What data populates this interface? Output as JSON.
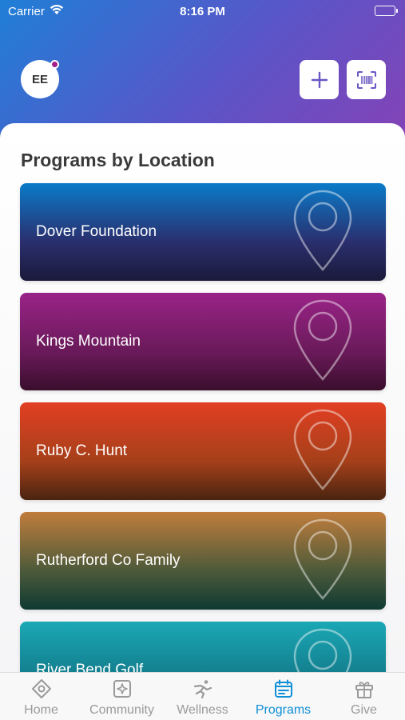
{
  "status_bar": {
    "carrier": "Carrier",
    "time": "8:16 PM"
  },
  "header": {
    "avatar_initials": "EE",
    "notification_dot_color": "#a11e8e",
    "add_icon": "plus-icon",
    "scan_icon": "barcode-scan-icon",
    "gradient_colors": [
      "#1f7fd6",
      "#5a55c8",
      "#8d3fb3"
    ]
  },
  "main": {
    "section_title": "Programs by Location",
    "locations": [
      {
        "name": "Dover Foundation",
        "gradient": [
          "#0a7bc9",
          "#2a2f6e",
          "#1a1a3a"
        ]
      },
      {
        "name": "Kings Mountain",
        "gradient": [
          "#9a2388",
          "#6a1a5a",
          "#3a0e2c"
        ]
      },
      {
        "name": "Ruby C. Hunt",
        "gradient": [
          "#e23f22",
          "#a6401a",
          "#4a2410"
        ]
      },
      {
        "name": "Rutherford Co Family",
        "gradient": [
          "#c07d3c",
          "#4d5a3a",
          "#0f3a32"
        ]
      },
      {
        "name": "River Bend Golf",
        "gradient": [
          "#1ba8b5",
          "#127a8a",
          "#0c5563"
        ]
      }
    ]
  },
  "tab_bar": {
    "active_color": "#0f8fd6",
    "inactive_color": "#9a9a9a",
    "tabs": [
      {
        "label": "Home",
        "icon": "home-diamond-icon",
        "active": false
      },
      {
        "label": "Community",
        "icon": "community-icon",
        "active": false
      },
      {
        "label": "Wellness",
        "icon": "wellness-icon",
        "active": false
      },
      {
        "label": "Programs",
        "icon": "programs-calendar-icon",
        "active": true
      },
      {
        "label": "Give",
        "icon": "gift-icon",
        "active": false
      }
    ]
  }
}
